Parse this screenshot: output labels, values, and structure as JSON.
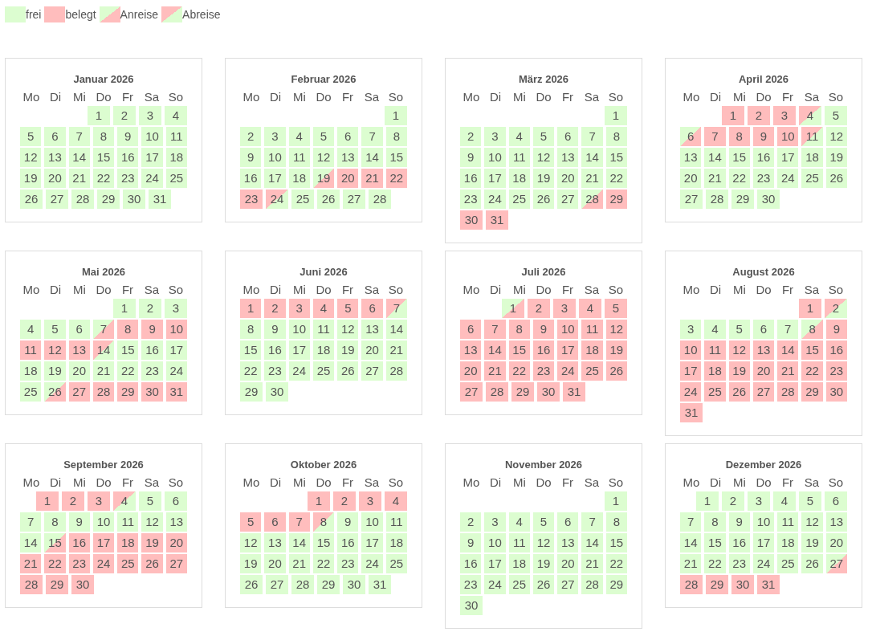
{
  "legend": [
    {
      "label": "frei",
      "kind": "free"
    },
    {
      "label": "belegt",
      "kind": "booked"
    },
    {
      "label": "Anreise",
      "kind": "arrival"
    },
    {
      "label": "Abreise",
      "kind": "departure"
    }
  ],
  "months": [
    {
      "title": "Januar 2026",
      "weekdays": [
        "Mo",
        "Di",
        "Mi",
        "Do",
        "Fr",
        "Sa",
        "So"
      ],
      "weeks": [
        [
          {
            "d": "1",
            "kind": "free"
          },
          {
            "d": "2",
            "kind": "free"
          },
          {
            "d": "3",
            "kind": "free"
          },
          {
            "d": "4",
            "kind": "free"
          }
        ],
        [
          {
            "d": "5",
            "kind": "free"
          },
          {
            "d": "6",
            "kind": "free"
          },
          {
            "d": "7",
            "kind": "free"
          },
          {
            "d": "8",
            "kind": "free"
          },
          {
            "d": "9",
            "kind": "free"
          },
          {
            "d": "10",
            "kind": "free"
          },
          {
            "d": "11",
            "kind": "free"
          }
        ],
        [
          {
            "d": "12",
            "kind": "free"
          },
          {
            "d": "13",
            "kind": "free"
          },
          {
            "d": "14",
            "kind": "free"
          },
          {
            "d": "15",
            "kind": "free"
          },
          {
            "d": "16",
            "kind": "free"
          },
          {
            "d": "17",
            "kind": "free"
          },
          {
            "d": "18",
            "kind": "free"
          }
        ],
        [
          {
            "d": "19",
            "kind": "free"
          },
          {
            "d": "20",
            "kind": "free"
          },
          {
            "d": "21",
            "kind": "free"
          },
          {
            "d": "22",
            "kind": "free"
          },
          {
            "d": "23",
            "kind": "free"
          },
          {
            "d": "24",
            "kind": "free"
          },
          {
            "d": "25",
            "kind": "free"
          }
        ],
        [
          {
            "d": "26",
            "kind": "free"
          },
          {
            "d": "27",
            "kind": "free"
          },
          {
            "d": "28",
            "kind": "free"
          },
          {
            "d": "29",
            "kind": "free"
          },
          {
            "d": "30",
            "kind": "free"
          },
          {
            "d": "31",
            "kind": "free"
          }
        ]
      ]
    },
    {
      "title": "Februar 2026",
      "weekdays": [
        "Mo",
        "Di",
        "Mi",
        "Do",
        "Fr",
        "Sa",
        "So"
      ],
      "weeks": [
        [
          {
            "d": "1",
            "kind": "free"
          }
        ],
        [
          {
            "d": "2",
            "kind": "free"
          },
          {
            "d": "3",
            "kind": "free"
          },
          {
            "d": "4",
            "kind": "free"
          },
          {
            "d": "5",
            "kind": "free"
          },
          {
            "d": "6",
            "kind": "free"
          },
          {
            "d": "7",
            "kind": "free"
          },
          {
            "d": "8",
            "kind": "free"
          }
        ],
        [
          {
            "d": "9",
            "kind": "free"
          },
          {
            "d": "10",
            "kind": "free"
          },
          {
            "d": "11",
            "kind": "free"
          },
          {
            "d": "12",
            "kind": "free"
          },
          {
            "d": "13",
            "kind": "free"
          },
          {
            "d": "14",
            "kind": "free"
          },
          {
            "d": "15",
            "kind": "free"
          }
        ],
        [
          {
            "d": "16",
            "kind": "free"
          },
          {
            "d": "17",
            "kind": "free"
          },
          {
            "d": "18",
            "kind": "free"
          },
          {
            "d": "19",
            "kind": "arrival"
          },
          {
            "d": "20",
            "kind": "booked"
          },
          {
            "d": "21",
            "kind": "booked"
          },
          {
            "d": "22",
            "kind": "booked"
          }
        ],
        [
          {
            "d": "23",
            "kind": "booked"
          },
          {
            "d": "24",
            "kind": "departure"
          },
          {
            "d": "25",
            "kind": "free"
          },
          {
            "d": "26",
            "kind": "free"
          },
          {
            "d": "27",
            "kind": "free"
          },
          {
            "d": "28",
            "kind": "free"
          }
        ]
      ]
    },
    {
      "title": "März 2026",
      "weekdays": [
        "Mo",
        "Di",
        "Mi",
        "Do",
        "Fr",
        "Sa",
        "So"
      ],
      "weeks": [
        [
          {
            "d": "1",
            "kind": "free"
          }
        ],
        [
          {
            "d": "2",
            "kind": "free"
          },
          {
            "d": "3",
            "kind": "free"
          },
          {
            "d": "4",
            "kind": "free"
          },
          {
            "d": "5",
            "kind": "free"
          },
          {
            "d": "6",
            "kind": "free"
          },
          {
            "d": "7",
            "kind": "free"
          },
          {
            "d": "8",
            "kind": "free"
          }
        ],
        [
          {
            "d": "9",
            "kind": "free"
          },
          {
            "d": "10",
            "kind": "free"
          },
          {
            "d": "11",
            "kind": "free"
          },
          {
            "d": "12",
            "kind": "free"
          },
          {
            "d": "13",
            "kind": "free"
          },
          {
            "d": "14",
            "kind": "free"
          },
          {
            "d": "15",
            "kind": "free"
          }
        ],
        [
          {
            "d": "16",
            "kind": "free"
          },
          {
            "d": "17",
            "kind": "free"
          },
          {
            "d": "18",
            "kind": "free"
          },
          {
            "d": "19",
            "kind": "free"
          },
          {
            "d": "20",
            "kind": "free"
          },
          {
            "d": "21",
            "kind": "free"
          },
          {
            "d": "22",
            "kind": "free"
          }
        ],
        [
          {
            "d": "23",
            "kind": "free"
          },
          {
            "d": "24",
            "kind": "free"
          },
          {
            "d": "25",
            "kind": "free"
          },
          {
            "d": "26",
            "kind": "free"
          },
          {
            "d": "27",
            "kind": "free"
          },
          {
            "d": "28",
            "kind": "arrival"
          },
          {
            "d": "29",
            "kind": "booked"
          }
        ],
        [
          {
            "d": "30",
            "kind": "booked"
          },
          {
            "d": "31",
            "kind": "booked"
          }
        ]
      ]
    },
    {
      "title": "April 2026",
      "weekdays": [
        "Mo",
        "Di",
        "Mi",
        "Do",
        "Fr",
        "Sa",
        "So"
      ],
      "weeks": [
        [
          {
            "d": "1",
            "kind": "booked"
          },
          {
            "d": "2",
            "kind": "booked"
          },
          {
            "d": "3",
            "kind": "booked"
          },
          {
            "d": "4",
            "kind": "departure"
          },
          {
            "d": "5",
            "kind": "free"
          }
        ],
        [
          {
            "d": "6",
            "kind": "arrival"
          },
          {
            "d": "7",
            "kind": "booked"
          },
          {
            "d": "8",
            "kind": "booked"
          },
          {
            "d": "9",
            "kind": "booked"
          },
          {
            "d": "10",
            "kind": "booked"
          },
          {
            "d": "11",
            "kind": "departure"
          },
          {
            "d": "12",
            "kind": "free"
          }
        ],
        [
          {
            "d": "13",
            "kind": "free"
          },
          {
            "d": "14",
            "kind": "free"
          },
          {
            "d": "15",
            "kind": "free"
          },
          {
            "d": "16",
            "kind": "free"
          },
          {
            "d": "17",
            "kind": "free"
          },
          {
            "d": "18",
            "kind": "free"
          },
          {
            "d": "19",
            "kind": "free"
          }
        ],
        [
          {
            "d": "20",
            "kind": "free"
          },
          {
            "d": "21",
            "kind": "free"
          },
          {
            "d": "22",
            "kind": "free"
          },
          {
            "d": "23",
            "kind": "free"
          },
          {
            "d": "24",
            "kind": "free"
          },
          {
            "d": "25",
            "kind": "free"
          },
          {
            "d": "26",
            "kind": "free"
          }
        ],
        [
          {
            "d": "27",
            "kind": "free"
          },
          {
            "d": "28",
            "kind": "free"
          },
          {
            "d": "29",
            "kind": "free"
          },
          {
            "d": "30",
            "kind": "free"
          }
        ]
      ]
    },
    {
      "title": "Mai 2026",
      "weekdays": [
        "Mo",
        "Di",
        "Mi",
        "Do",
        "Fr",
        "Sa",
        "So"
      ],
      "weeks": [
        [
          {
            "d": "1",
            "kind": "free"
          },
          {
            "d": "2",
            "kind": "free"
          },
          {
            "d": "3",
            "kind": "free"
          }
        ],
        [
          {
            "d": "4",
            "kind": "free"
          },
          {
            "d": "5",
            "kind": "free"
          },
          {
            "d": "6",
            "kind": "free"
          },
          {
            "d": "7",
            "kind": "arrival"
          },
          {
            "d": "8",
            "kind": "booked"
          },
          {
            "d": "9",
            "kind": "booked"
          },
          {
            "d": "10",
            "kind": "booked"
          }
        ],
        [
          {
            "d": "11",
            "kind": "booked"
          },
          {
            "d": "12",
            "kind": "booked"
          },
          {
            "d": "13",
            "kind": "booked"
          },
          {
            "d": "14",
            "kind": "departure"
          },
          {
            "d": "15",
            "kind": "free"
          },
          {
            "d": "16",
            "kind": "free"
          },
          {
            "d": "17",
            "kind": "free"
          }
        ],
        [
          {
            "d": "18",
            "kind": "free"
          },
          {
            "d": "19",
            "kind": "free"
          },
          {
            "d": "20",
            "kind": "free"
          },
          {
            "d": "21",
            "kind": "free"
          },
          {
            "d": "22",
            "kind": "free"
          },
          {
            "d": "23",
            "kind": "free"
          },
          {
            "d": "24",
            "kind": "free"
          }
        ],
        [
          {
            "d": "25",
            "kind": "free"
          },
          {
            "d": "26",
            "kind": "arrival"
          },
          {
            "d": "27",
            "kind": "booked"
          },
          {
            "d": "28",
            "kind": "booked"
          },
          {
            "d": "29",
            "kind": "booked"
          },
          {
            "d": "30",
            "kind": "booked"
          },
          {
            "d": "31",
            "kind": "booked"
          }
        ]
      ]
    },
    {
      "title": "Juni 2026",
      "weekdays": [
        "Mo",
        "Di",
        "Mi",
        "Do",
        "Fr",
        "Sa",
        "So"
      ],
      "weeks": [
        [
          {
            "d": "1",
            "kind": "booked"
          },
          {
            "d": "2",
            "kind": "booked"
          },
          {
            "d": "3",
            "kind": "booked"
          },
          {
            "d": "4",
            "kind": "booked"
          },
          {
            "d": "5",
            "kind": "booked"
          },
          {
            "d": "6",
            "kind": "booked"
          },
          {
            "d": "7",
            "kind": "departure"
          }
        ],
        [
          {
            "d": "8",
            "kind": "free"
          },
          {
            "d": "9",
            "kind": "free"
          },
          {
            "d": "10",
            "kind": "free"
          },
          {
            "d": "11",
            "kind": "free"
          },
          {
            "d": "12",
            "kind": "free"
          },
          {
            "d": "13",
            "kind": "free"
          },
          {
            "d": "14",
            "kind": "free"
          }
        ],
        [
          {
            "d": "15",
            "kind": "free"
          },
          {
            "d": "16",
            "kind": "free"
          },
          {
            "d": "17",
            "kind": "free"
          },
          {
            "d": "18",
            "kind": "free"
          },
          {
            "d": "19",
            "kind": "free"
          },
          {
            "d": "20",
            "kind": "free"
          },
          {
            "d": "21",
            "kind": "free"
          }
        ],
        [
          {
            "d": "22",
            "kind": "free"
          },
          {
            "d": "23",
            "kind": "free"
          },
          {
            "d": "24",
            "kind": "free"
          },
          {
            "d": "25",
            "kind": "free"
          },
          {
            "d": "26",
            "kind": "free"
          },
          {
            "d": "27",
            "kind": "free"
          },
          {
            "d": "28",
            "kind": "free"
          }
        ],
        [
          {
            "d": "29",
            "kind": "free"
          },
          {
            "d": "30",
            "kind": "free"
          }
        ]
      ]
    },
    {
      "title": "Juli 2026",
      "weekdays": [
        "Mo",
        "Di",
        "Mi",
        "Do",
        "Fr",
        "Sa",
        "So"
      ],
      "weeks": [
        [
          {
            "d": "1",
            "kind": "arrival"
          },
          {
            "d": "2",
            "kind": "booked"
          },
          {
            "d": "3",
            "kind": "booked"
          },
          {
            "d": "4",
            "kind": "booked"
          },
          {
            "d": "5",
            "kind": "booked"
          }
        ],
        [
          {
            "d": "6",
            "kind": "booked"
          },
          {
            "d": "7",
            "kind": "booked"
          },
          {
            "d": "8",
            "kind": "booked"
          },
          {
            "d": "9",
            "kind": "booked"
          },
          {
            "d": "10",
            "kind": "booked"
          },
          {
            "d": "11",
            "kind": "booked"
          },
          {
            "d": "12",
            "kind": "booked"
          }
        ],
        [
          {
            "d": "13",
            "kind": "booked"
          },
          {
            "d": "14",
            "kind": "booked"
          },
          {
            "d": "15",
            "kind": "booked"
          },
          {
            "d": "16",
            "kind": "booked"
          },
          {
            "d": "17",
            "kind": "booked"
          },
          {
            "d": "18",
            "kind": "booked"
          },
          {
            "d": "19",
            "kind": "booked"
          }
        ],
        [
          {
            "d": "20",
            "kind": "booked"
          },
          {
            "d": "21",
            "kind": "booked"
          },
          {
            "d": "22",
            "kind": "booked"
          },
          {
            "d": "23",
            "kind": "booked"
          },
          {
            "d": "24",
            "kind": "booked"
          },
          {
            "d": "25",
            "kind": "booked"
          },
          {
            "d": "26",
            "kind": "booked"
          }
        ],
        [
          {
            "d": "27",
            "kind": "booked"
          },
          {
            "d": "28",
            "kind": "booked"
          },
          {
            "d": "29",
            "kind": "booked"
          },
          {
            "d": "30",
            "kind": "booked"
          },
          {
            "d": "31",
            "kind": "booked"
          }
        ]
      ]
    },
    {
      "title": "August 2026",
      "weekdays": [
        "Mo",
        "Di",
        "Mi",
        "Do",
        "Fr",
        "Sa",
        "So"
      ],
      "weeks": [
        [
          {
            "d": "1",
            "kind": "booked"
          },
          {
            "d": "2",
            "kind": "departure"
          }
        ],
        [
          {
            "d": "3",
            "kind": "free"
          },
          {
            "d": "4",
            "kind": "free"
          },
          {
            "d": "5",
            "kind": "free"
          },
          {
            "d": "6",
            "kind": "free"
          },
          {
            "d": "7",
            "kind": "free"
          },
          {
            "d": "8",
            "kind": "arrival"
          },
          {
            "d": "9",
            "kind": "booked"
          }
        ],
        [
          {
            "d": "10",
            "kind": "booked"
          },
          {
            "d": "11",
            "kind": "booked"
          },
          {
            "d": "12",
            "kind": "booked"
          },
          {
            "d": "13",
            "kind": "booked"
          },
          {
            "d": "14",
            "kind": "booked"
          },
          {
            "d": "15",
            "kind": "booked"
          },
          {
            "d": "16",
            "kind": "booked"
          }
        ],
        [
          {
            "d": "17",
            "kind": "booked"
          },
          {
            "d": "18",
            "kind": "booked"
          },
          {
            "d": "19",
            "kind": "booked"
          },
          {
            "d": "20",
            "kind": "booked"
          },
          {
            "d": "21",
            "kind": "booked"
          },
          {
            "d": "22",
            "kind": "booked"
          },
          {
            "d": "23",
            "kind": "booked"
          }
        ],
        [
          {
            "d": "24",
            "kind": "booked"
          },
          {
            "d": "25",
            "kind": "booked"
          },
          {
            "d": "26",
            "kind": "booked"
          },
          {
            "d": "27",
            "kind": "booked"
          },
          {
            "d": "28",
            "kind": "booked"
          },
          {
            "d": "29",
            "kind": "booked"
          },
          {
            "d": "30",
            "kind": "booked"
          }
        ],
        [
          {
            "d": "31",
            "kind": "booked"
          }
        ]
      ]
    },
    {
      "title": "September 2026",
      "weekdays": [
        "Mo",
        "Di",
        "Mi",
        "Do",
        "Fr",
        "Sa",
        "So"
      ],
      "weeks": [
        [
          {
            "d": "1",
            "kind": "booked"
          },
          {
            "d": "2",
            "kind": "booked"
          },
          {
            "d": "3",
            "kind": "booked"
          },
          {
            "d": "4",
            "kind": "departure"
          },
          {
            "d": "5",
            "kind": "free"
          },
          {
            "d": "6",
            "kind": "free"
          }
        ],
        [
          {
            "d": "7",
            "kind": "free"
          },
          {
            "d": "8",
            "kind": "free"
          },
          {
            "d": "9",
            "kind": "free"
          },
          {
            "d": "10",
            "kind": "free"
          },
          {
            "d": "11",
            "kind": "free"
          },
          {
            "d": "12",
            "kind": "free"
          },
          {
            "d": "13",
            "kind": "free"
          }
        ],
        [
          {
            "d": "14",
            "kind": "free"
          },
          {
            "d": "15",
            "kind": "arrival"
          },
          {
            "d": "16",
            "kind": "booked"
          },
          {
            "d": "17",
            "kind": "booked"
          },
          {
            "d": "18",
            "kind": "booked"
          },
          {
            "d": "19",
            "kind": "booked"
          },
          {
            "d": "20",
            "kind": "booked"
          }
        ],
        [
          {
            "d": "21",
            "kind": "booked"
          },
          {
            "d": "22",
            "kind": "booked"
          },
          {
            "d": "23",
            "kind": "booked"
          },
          {
            "d": "24",
            "kind": "booked"
          },
          {
            "d": "25",
            "kind": "booked"
          },
          {
            "d": "26",
            "kind": "booked"
          },
          {
            "d": "27",
            "kind": "booked"
          }
        ],
        [
          {
            "d": "28",
            "kind": "booked"
          },
          {
            "d": "29",
            "kind": "booked"
          },
          {
            "d": "30",
            "kind": "booked"
          }
        ]
      ]
    },
    {
      "title": "Oktober 2026",
      "weekdays": [
        "Mo",
        "Di",
        "Mi",
        "Do",
        "Fr",
        "Sa",
        "So"
      ],
      "weeks": [
        [
          {
            "d": "1",
            "kind": "booked"
          },
          {
            "d": "2",
            "kind": "booked"
          },
          {
            "d": "3",
            "kind": "booked"
          },
          {
            "d": "4",
            "kind": "booked"
          }
        ],
        [
          {
            "d": "5",
            "kind": "booked"
          },
          {
            "d": "6",
            "kind": "booked"
          },
          {
            "d": "7",
            "kind": "booked"
          },
          {
            "d": "8",
            "kind": "departure"
          },
          {
            "d": "9",
            "kind": "free"
          },
          {
            "d": "10",
            "kind": "free"
          },
          {
            "d": "11",
            "kind": "free"
          }
        ],
        [
          {
            "d": "12",
            "kind": "free"
          },
          {
            "d": "13",
            "kind": "free"
          },
          {
            "d": "14",
            "kind": "free"
          },
          {
            "d": "15",
            "kind": "free"
          },
          {
            "d": "16",
            "kind": "free"
          },
          {
            "d": "17",
            "kind": "free"
          },
          {
            "d": "18",
            "kind": "free"
          }
        ],
        [
          {
            "d": "19",
            "kind": "free"
          },
          {
            "d": "20",
            "kind": "free"
          },
          {
            "d": "21",
            "kind": "free"
          },
          {
            "d": "22",
            "kind": "free"
          },
          {
            "d": "23",
            "kind": "free"
          },
          {
            "d": "24",
            "kind": "free"
          },
          {
            "d": "25",
            "kind": "free"
          }
        ],
        [
          {
            "d": "26",
            "kind": "free"
          },
          {
            "d": "27",
            "kind": "free"
          },
          {
            "d": "28",
            "kind": "free"
          },
          {
            "d": "29",
            "kind": "free"
          },
          {
            "d": "30",
            "kind": "free"
          },
          {
            "d": "31",
            "kind": "free"
          }
        ]
      ]
    },
    {
      "title": "November 2026",
      "weekdays": [
        "Mo",
        "Di",
        "Mi",
        "Do",
        "Fr",
        "Sa",
        "So"
      ],
      "weeks": [
        [
          {
            "d": "1",
            "kind": "free"
          }
        ],
        [
          {
            "d": "2",
            "kind": "free"
          },
          {
            "d": "3",
            "kind": "free"
          },
          {
            "d": "4",
            "kind": "free"
          },
          {
            "d": "5",
            "kind": "free"
          },
          {
            "d": "6",
            "kind": "free"
          },
          {
            "d": "7",
            "kind": "free"
          },
          {
            "d": "8",
            "kind": "free"
          }
        ],
        [
          {
            "d": "9",
            "kind": "free"
          },
          {
            "d": "10",
            "kind": "free"
          },
          {
            "d": "11",
            "kind": "free"
          },
          {
            "d": "12",
            "kind": "free"
          },
          {
            "d": "13",
            "kind": "free"
          },
          {
            "d": "14",
            "kind": "free"
          },
          {
            "d": "15",
            "kind": "free"
          }
        ],
        [
          {
            "d": "16",
            "kind": "free"
          },
          {
            "d": "17",
            "kind": "free"
          },
          {
            "d": "18",
            "kind": "free"
          },
          {
            "d": "19",
            "kind": "free"
          },
          {
            "d": "20",
            "kind": "free"
          },
          {
            "d": "21",
            "kind": "free"
          },
          {
            "d": "22",
            "kind": "free"
          }
        ],
        [
          {
            "d": "23",
            "kind": "free"
          },
          {
            "d": "24",
            "kind": "free"
          },
          {
            "d": "25",
            "kind": "free"
          },
          {
            "d": "26",
            "kind": "free"
          },
          {
            "d": "27",
            "kind": "free"
          },
          {
            "d": "28",
            "kind": "free"
          },
          {
            "d": "29",
            "kind": "free"
          }
        ],
        [
          {
            "d": "30",
            "kind": "free"
          }
        ]
      ]
    },
    {
      "title": "Dezember 2026",
      "weekdays": [
        "Mo",
        "Di",
        "Mi",
        "Do",
        "Fr",
        "Sa",
        "So"
      ],
      "weeks": [
        [
          {
            "d": "1",
            "kind": "free"
          },
          {
            "d": "2",
            "kind": "free"
          },
          {
            "d": "3",
            "kind": "free"
          },
          {
            "d": "4",
            "kind": "free"
          },
          {
            "d": "5",
            "kind": "free"
          },
          {
            "d": "6",
            "kind": "free"
          }
        ],
        [
          {
            "d": "7",
            "kind": "free"
          },
          {
            "d": "8",
            "kind": "free"
          },
          {
            "d": "9",
            "kind": "free"
          },
          {
            "d": "10",
            "kind": "free"
          },
          {
            "d": "11",
            "kind": "free"
          },
          {
            "d": "12",
            "kind": "free"
          },
          {
            "d": "13",
            "kind": "free"
          }
        ],
        [
          {
            "d": "14",
            "kind": "free"
          },
          {
            "d": "15",
            "kind": "free"
          },
          {
            "d": "16",
            "kind": "free"
          },
          {
            "d": "17",
            "kind": "free"
          },
          {
            "d": "18",
            "kind": "free"
          },
          {
            "d": "19",
            "kind": "free"
          },
          {
            "d": "20",
            "kind": "free"
          }
        ],
        [
          {
            "d": "21",
            "kind": "free"
          },
          {
            "d": "22",
            "kind": "free"
          },
          {
            "d": "23",
            "kind": "free"
          },
          {
            "d": "24",
            "kind": "free"
          },
          {
            "d": "25",
            "kind": "free"
          },
          {
            "d": "26",
            "kind": "free"
          },
          {
            "d": "27",
            "kind": "arrival"
          }
        ],
        [
          {
            "d": "28",
            "kind": "booked"
          },
          {
            "d": "29",
            "kind": "booked"
          },
          {
            "d": "30",
            "kind": "booked"
          },
          {
            "d": "31",
            "kind": "booked"
          }
        ]
      ]
    }
  ]
}
